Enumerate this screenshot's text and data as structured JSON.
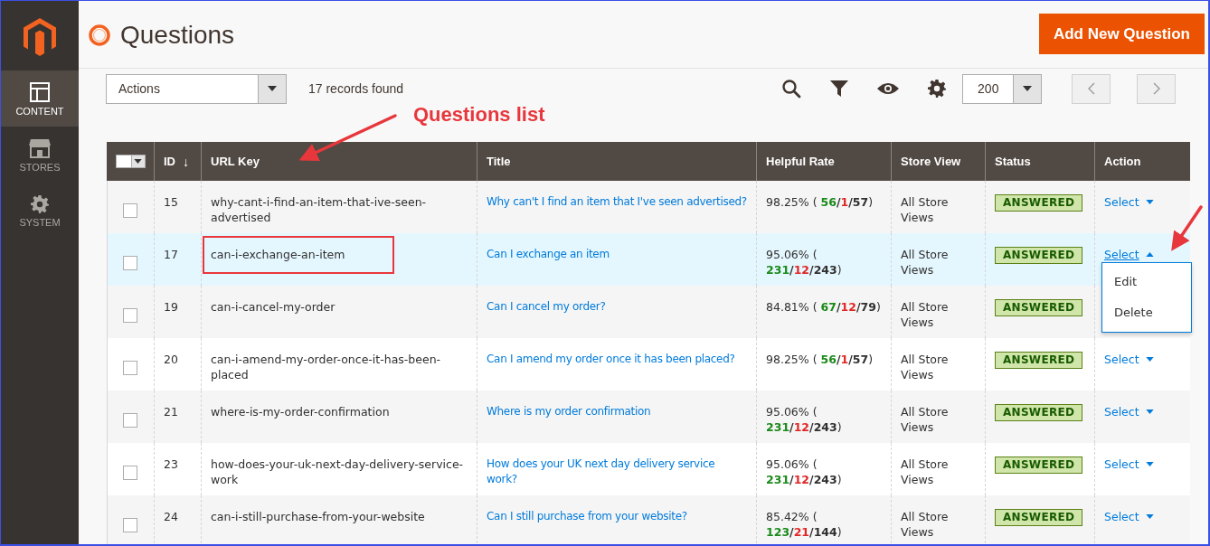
{
  "sidebar": {
    "items": [
      {
        "label": "CONTENT",
        "selected": true
      },
      {
        "label": "STORES",
        "selected": false
      },
      {
        "label": "SYSTEM",
        "selected": false
      }
    ]
  },
  "page": {
    "title": "Questions",
    "primary_button": "Add New Question"
  },
  "toolbar": {
    "actions": "Actions",
    "records": "17 records found",
    "per_page": "200"
  },
  "annotation": {
    "label": "Questions list"
  },
  "table": {
    "select_all_checked": false,
    "columns": [
      {
        "label": "ID",
        "sort_mark": "↓"
      },
      {
        "label": "URL Key"
      },
      {
        "label": "Title"
      },
      {
        "label": "Helpful Rate"
      },
      {
        "label": "Store View"
      },
      {
        "label": "Status"
      },
      {
        "label": "Action"
      }
    ],
    "rows": [
      {
        "checked": false,
        "highlighted": false,
        "marked": false,
        "id": "15",
        "url_key": "why-cant-i-find-an-item-that-ive-seen-advertised",
        "title": "Why can't I find an item that I've seen advertised?",
        "helpful_rate": [
          {
            "kind": "plain",
            "text": "98.25% ( "
          },
          {
            "kind": "up",
            "text": "56"
          },
          {
            "kind": "sep",
            "text": "/"
          },
          {
            "kind": "down",
            "text": "1"
          },
          {
            "kind": "sep",
            "text": "/"
          },
          {
            "kind": "total",
            "text": "57"
          },
          {
            "kind": "plain",
            "text": ")"
          }
        ],
        "store_view": "All Store Views",
        "status": {
          "label": "ANSWERED",
          "kind": "answered"
        },
        "action": "Select",
        "menu_open": false
      },
      {
        "checked": false,
        "highlighted": true,
        "marked": true,
        "id": "17",
        "url_key": "can-i-exchange-an-item",
        "title": "Can I exchange an item",
        "helpful_rate": [
          {
            "kind": "plain",
            "text": "95.06% ( "
          },
          {
            "kind": "up",
            "text": "231"
          },
          {
            "kind": "sep",
            "text": "/"
          },
          {
            "kind": "down",
            "text": "12"
          },
          {
            "kind": "sep",
            "text": "/"
          },
          {
            "kind": "total",
            "text": "243"
          },
          {
            "kind": "plain",
            "text": ")"
          }
        ],
        "store_view": "All Store Views",
        "status": {
          "label": "ANSWERED",
          "kind": "answered"
        },
        "action": "Select",
        "menu_open": true,
        "menu": [
          {
            "label": "Edit"
          },
          {
            "label": "Delete"
          }
        ]
      },
      {
        "checked": false,
        "highlighted": false,
        "marked": false,
        "id": "19",
        "url_key": "can-i-cancel-my-order",
        "title": "Can I cancel my order?",
        "helpful_rate": [
          {
            "kind": "plain",
            "text": "84.81% ( "
          },
          {
            "kind": "up",
            "text": "67"
          },
          {
            "kind": "sep",
            "text": "/"
          },
          {
            "kind": "down",
            "text": "12"
          },
          {
            "kind": "sep",
            "text": "/"
          },
          {
            "kind": "total",
            "text": "79"
          },
          {
            "kind": "plain",
            "text": ")"
          }
        ],
        "store_view": "All Store Views",
        "status": {
          "label": "ANSWERED",
          "kind": "answered"
        }
      },
      {
        "checked": false,
        "highlighted": false,
        "marked": false,
        "id": "20",
        "url_key": "can-i-amend-my-order-once-it-has-been-placed",
        "title": "Can I amend my order once it has been placed?",
        "helpful_rate": [
          {
            "kind": "plain",
            "text": "98.25% ( "
          },
          {
            "kind": "up",
            "text": "56"
          },
          {
            "kind": "sep",
            "text": "/"
          },
          {
            "kind": "down",
            "text": "1"
          },
          {
            "kind": "sep",
            "text": "/"
          },
          {
            "kind": "total",
            "text": "57"
          },
          {
            "kind": "plain",
            "text": ")"
          }
        ],
        "store_view": "All Store Views",
        "status": {
          "label": "ANSWERED",
          "kind": "answered"
        },
        "action": "Select",
        "menu_open": false
      },
      {
        "checked": false,
        "highlighted": false,
        "marked": false,
        "id": "21",
        "url_key": "where-is-my-order-confirmation",
        "title": "Where is my order confirmation",
        "helpful_rate": [
          {
            "kind": "plain",
            "text": "95.06% ( "
          },
          {
            "kind": "up",
            "text": "231"
          },
          {
            "kind": "sep",
            "text": "/"
          },
          {
            "kind": "down",
            "text": "12"
          },
          {
            "kind": "sep",
            "text": "/"
          },
          {
            "kind": "total",
            "text": "243"
          },
          {
            "kind": "plain",
            "text": ")"
          }
        ],
        "store_view": "All Store Views",
        "status": {
          "label": "ANSWERED",
          "kind": "answered"
        },
        "action": "Select",
        "menu_open": false
      },
      {
        "checked": false,
        "highlighted": false,
        "marked": false,
        "id": "23",
        "url_key": "how-does-your-uk-next-day-delivery-service-work",
        "title": "How does your UK next day delivery service work?",
        "helpful_rate": [
          {
            "kind": "plain",
            "text": "95.06% ( "
          },
          {
            "kind": "up",
            "text": "231"
          },
          {
            "kind": "sep",
            "text": "/"
          },
          {
            "kind": "down",
            "text": "12"
          },
          {
            "kind": "sep",
            "text": "/"
          },
          {
            "kind": "total",
            "text": "243"
          },
          {
            "kind": "plain",
            "text": ")"
          }
        ],
        "store_view": "All Store Views",
        "status": {
          "label": "ANSWERED",
          "kind": "answered"
        },
        "action": "Select",
        "menu_open": false
      },
      {
        "checked": false,
        "highlighted": false,
        "marked": false,
        "id": "24",
        "url_key": "can-i-still-purchase-from-your-website",
        "title": "Can I still purchase from your website?",
        "helpful_rate": [
          {
            "kind": "plain",
            "text": "85.42% ( "
          },
          {
            "kind": "up",
            "text": "123"
          },
          {
            "kind": "sep",
            "text": "/"
          },
          {
            "kind": "down",
            "text": "21"
          },
          {
            "kind": "sep",
            "text": "/"
          },
          {
            "kind": "total",
            "text": "144"
          },
          {
            "kind": "plain",
            "text": ")"
          }
        ],
        "store_view": "All Store Views",
        "status": {
          "label": "ANSWERED",
          "kind": "answered"
        },
        "action": "Select",
        "menu_open": false
      }
    ]
  }
}
